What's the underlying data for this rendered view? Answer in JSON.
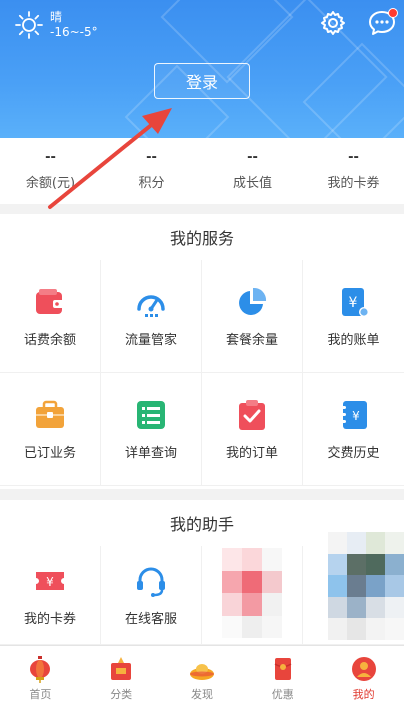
{
  "weather": {
    "condition": "晴",
    "temp": "-16~-5°"
  },
  "login_label": "登录",
  "stats": [
    {
      "value": "--",
      "label": "余额(元)"
    },
    {
      "value": "--",
      "label": "积分"
    },
    {
      "value": "--",
      "label": "成长值"
    },
    {
      "value": "--",
      "label": "我的卡券"
    }
  ],
  "services": {
    "title": "我的服务",
    "items": [
      {
        "label": "话费余额",
        "icon": "wallet-icon",
        "color": "#ef4f5b"
      },
      {
        "label": "流量管家",
        "icon": "speedometer-icon",
        "color": "#2c8ee8"
      },
      {
        "label": "套餐余量",
        "icon": "pie-chart-icon",
        "color": "#2c8ee8"
      },
      {
        "label": "我的账单",
        "icon": "bill-icon",
        "color": "#2c8ee8"
      },
      {
        "label": "已订业务",
        "icon": "briefcase-icon",
        "color": "#f2a33a"
      },
      {
        "label": "详单查询",
        "icon": "list-icon",
        "color": "#28b574"
      },
      {
        "label": "我的订单",
        "icon": "clipboard-check-icon",
        "color": "#ef4f5b"
      },
      {
        "label": "交费历史",
        "icon": "notebook-icon",
        "color": "#2c8ee8"
      }
    ]
  },
  "assistant": {
    "title": "我的助手",
    "items": [
      {
        "label": "我的卡券",
        "icon": "ticket-icon",
        "color": "#ef4f5b"
      },
      {
        "label": "在线客服",
        "icon": "headset-icon",
        "color": "#2c8ee8"
      }
    ]
  },
  "tabs": [
    {
      "label": "首页",
      "icon": "lantern-icon",
      "active": false
    },
    {
      "label": "分类",
      "icon": "category-icon",
      "active": false
    },
    {
      "label": "发现",
      "icon": "ingot-icon",
      "active": false
    },
    {
      "label": "优惠",
      "icon": "red-envelope-icon",
      "active": false
    },
    {
      "label": "我的",
      "icon": "profile-icon",
      "active": true
    }
  ],
  "colors": {
    "header_blue": "#3b8ff0",
    "accent_red": "#e03a2f"
  }
}
